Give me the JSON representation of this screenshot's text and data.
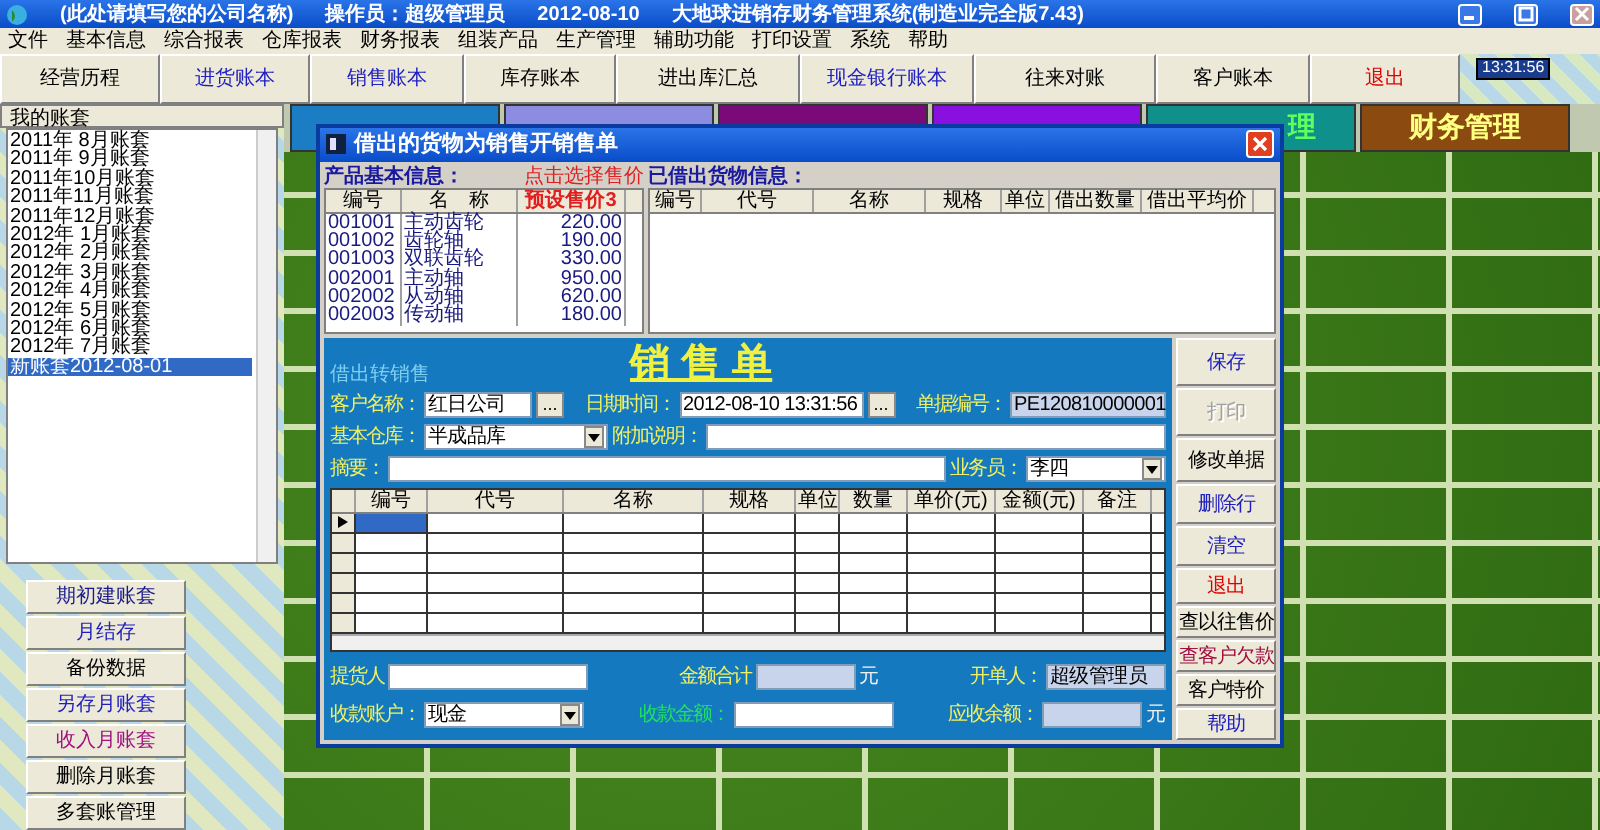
{
  "window": {
    "company": "(此处请填写您的公司名称)",
    "operator": "操作员：超级管理员",
    "date": "2012-08-10",
    "title": "大地球进销存财务管理系统(制造业完全版7.43)"
  },
  "menu": [
    "文件",
    "基本信息",
    "综合报表",
    "仓库报表",
    "财务报表",
    "组装产品",
    "生产管理",
    "辅助功能",
    "打印设置",
    "系统",
    "帮助"
  ],
  "toolbar": [
    {
      "label": "经营历程",
      "color": "#000000"
    },
    {
      "label": "进货账本",
      "color": "#2020c0"
    },
    {
      "label": "销售账本",
      "color": "#2020c0"
    },
    {
      "label": "库存账本",
      "color": "#000000"
    },
    {
      "label": "进出库汇总",
      "color": "#000000"
    },
    {
      "label": "现金银行账本",
      "color": "#2020c0"
    },
    {
      "label": "往来对账",
      "color": "#000000"
    },
    {
      "label": "客户账本",
      "color": "#000000"
    },
    {
      "label": "退出",
      "color": "#e00000"
    }
  ],
  "clock": "13:31:56",
  "accounts": {
    "title": "我的账套",
    "items": [
      {
        "label": "2011年 8月账套",
        "selected": false
      },
      {
        "label": "2011年 9月账套",
        "selected": false
      },
      {
        "label": "2011年10月账套",
        "selected": false
      },
      {
        "label": "2011年11月账套",
        "selected": false
      },
      {
        "label": "2011年12月账套",
        "selected": false
      },
      {
        "label": "2012年 1月账套",
        "selected": false
      },
      {
        "label": "2012年 2月账套",
        "selected": false
      },
      {
        "label": "2012年 3月账套",
        "selected": false
      },
      {
        "label": "2012年 4月账套",
        "selected": false
      },
      {
        "label": "2012年 5月账套",
        "selected": false
      },
      {
        "label": "2012年 6月账套",
        "selected": false
      },
      {
        "label": "2012年 7月账套",
        "selected": false
      },
      {
        "label": "新账套2012-08-01",
        "selected": true
      }
    ]
  },
  "account_buttons": [
    {
      "label": "期初建账套",
      "color": "#1a1a8c"
    },
    {
      "label": "月结存",
      "color": "#2020c0"
    },
    {
      "label": "备份数据",
      "color": "#000000"
    },
    {
      "label": "另存月账套",
      "color": "#2020c0"
    },
    {
      "label": "收入月账套",
      "color": "#a01080"
    },
    {
      "label": "删除月账套",
      "color": "#000000"
    },
    {
      "label": "多套账管理",
      "color": "#000000"
    }
  ],
  "modules": [
    {
      "color": "#1b7dc4"
    },
    {
      "color": "#8c8ce0"
    },
    {
      "color": "#7a0a7a"
    },
    {
      "color": "#8a10e0"
    },
    {
      "label": "理",
      "color": "#10908a"
    },
    {
      "label": "财务管理",
      "color": "#8a4a10"
    }
  ],
  "dialog": {
    "title": "借出的货物为销售开销售单",
    "products": {
      "label": "产品基本信息：",
      "hint": "点击选择售价",
      "columns": [
        "编号",
        "名　称",
        "预设售价3"
      ],
      "rows": [
        [
          "001001",
          "主动齿轮",
          "220.00"
        ],
        [
          "001002",
          "齿轮轴",
          "190.00"
        ],
        [
          "001003",
          "双联齿轮",
          "330.00"
        ],
        [
          "002001",
          "主动轴",
          "950.00"
        ],
        [
          "002002",
          "从动轴",
          "620.00"
        ],
        [
          "002003",
          "传动轴",
          "180.00"
        ]
      ]
    },
    "lent": {
      "label": "已借出货物信息：",
      "columns": [
        "编号",
        "代号",
        "名称",
        "规格",
        "单位",
        "借出数量",
        "借出平均价"
      ]
    },
    "form": {
      "source": "借出转销售",
      "heading": "销 售 单",
      "lines": [
        {
          "fields": [
            {
              "kind": "picker",
              "label": "客户名称：",
              "value": "红日公司",
              "button": "...",
              "color": "#f0f060"
            },
            {
              "kind": "picker",
              "label": "日期时间：",
              "value": "2012-08-10 13:31:56",
              "button": "...",
              "color": "#f0f060"
            },
            {
              "kind": "readonly",
              "label": "单据编号：",
              "value": "PE120810000001",
              "color": "#f0f060"
            }
          ]
        },
        {
          "fields": [
            {
              "kind": "select",
              "label": "基本仓库：",
              "value": "半成品库",
              "color": "#f0f060"
            },
            {
              "kind": "text",
              "label": "附加说明：",
              "color": "#f0f060"
            }
          ]
        },
        {
          "fields": [
            {
              "kind": "text",
              "label": "摘要：",
              "color": "#f0f060"
            },
            {
              "kind": "select",
              "label": "业务员：",
              "value": "李四",
              "color": "#f0f060"
            }
          ]
        }
      ],
      "grid_columns": [
        "编号",
        "代号",
        "名称",
        "规格",
        "单位",
        "数量",
        "单价(元)",
        "金额(元)",
        "备注"
      ],
      "footer": [
        {
          "fields": [
            {
              "kind": "text",
              "label": "提货人",
              "color": "#f0f060"
            },
            {
              "kind": "readonly",
              "label": "金额合计",
              "unit": "元",
              "color": "#f0f060"
            },
            {
              "kind": "readonly",
              "label": "开单人：",
              "value": "超级管理员",
              "color": "#f0f060"
            }
          ]
        },
        {
          "fields": [
            {
              "kind": "select",
              "label": "收款账户：",
              "value": "现金",
              "color": "#f0f060"
            },
            {
              "kind": "text",
              "label": "收款金额：",
              "color": "#20e060"
            },
            {
              "kind": "readonly",
              "label": "应收余额：",
              "unit": "元",
              "color": "#f0f060"
            }
          ]
        }
      ]
    },
    "buttons": [
      {
        "label": "保存",
        "color": "#2020c0",
        "disabled": false
      },
      {
        "label": "打印",
        "color": "#a0a0a0",
        "disabled": true
      },
      {
        "label": "修改单据",
        "color": "#000000",
        "disabled": false
      },
      {
        "label": "删除行",
        "color": "#2020c0",
        "disabled": false
      },
      {
        "label": "清空",
        "color": "#2020c0",
        "disabled": false
      },
      {
        "label": "退出",
        "color": "#e00000",
        "disabled": false
      },
      {
        "label": "查以往售价",
        "color": "#000000",
        "disabled": false
      },
      {
        "label": "查客户欠款",
        "color": "#a01040",
        "disabled": false
      },
      {
        "label": "客户特价",
        "color": "#000000",
        "disabled": false
      },
      {
        "label": "帮助",
        "color": "#2020c0",
        "disabled": false
      }
    ]
  }
}
